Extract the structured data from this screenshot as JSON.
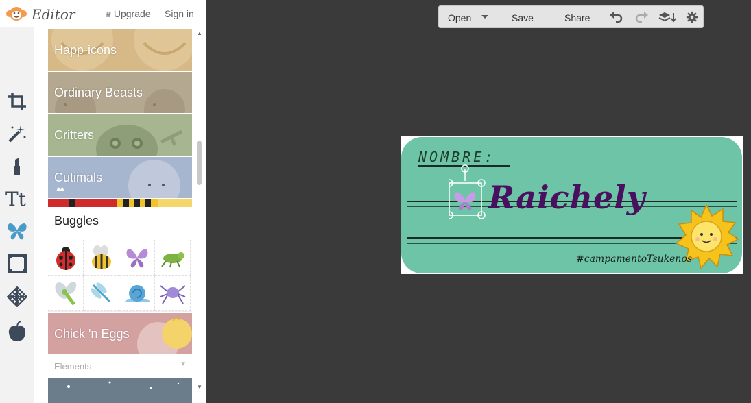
{
  "header": {
    "logo_text": "Editor",
    "upgrade_label": "Upgrade",
    "signin_label": "Sign in"
  },
  "tools": [
    "crop-icon",
    "magic-wand-icon",
    "lipstick-icon",
    "text-icon",
    "butterfly-icon",
    "frame-icon",
    "texture-icon",
    "apple-icon"
  ],
  "library": {
    "packs": [
      {
        "label": "Happ-icons",
        "color": "#d7b987"
      },
      {
        "label": "Ordinary Beasts",
        "color": "#b5a890"
      },
      {
        "label": "Critters",
        "color": "#a7b690"
      },
      {
        "label": "Cutimals",
        "color": "#a7b6cf"
      },
      {
        "label": "Chick 'n Eggs",
        "color": "#d4a1a1"
      }
    ],
    "expanded_pack": {
      "title": "Buggles",
      "stickers": [
        "ladybug-sticker",
        "bee-sticker",
        "butterfly-sticker",
        "grasshopper-sticker",
        "dragonfly-sticker",
        "blue-dragonfly-sticker",
        "snail-sticker",
        "spider-sticker"
      ]
    },
    "elements_dropdown": "Elements"
  },
  "toolbar": {
    "open_label": "Open",
    "save_label": "Save",
    "share_label": "Share"
  },
  "design": {
    "label_text": "NOMBRE:",
    "name": "Raichely",
    "hashtag": "#campamentoTsukenos",
    "card_color": "#6ec4a7"
  }
}
